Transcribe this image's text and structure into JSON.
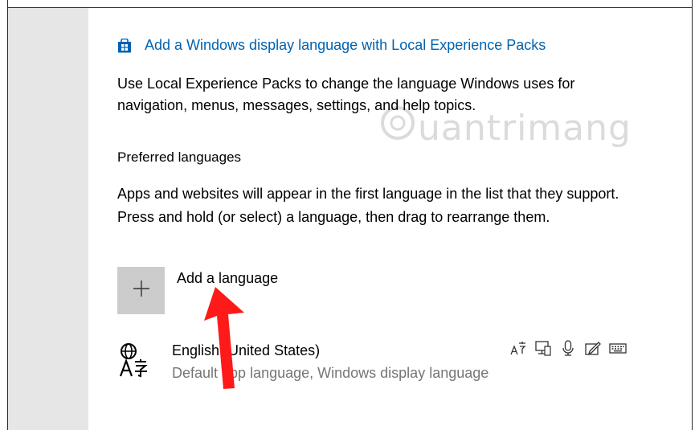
{
  "links": {
    "lxp": "Add a Windows display language with Local Experience Packs"
  },
  "description": "Use Local Experience Packs to change the language Windows uses for navigation, menus, messages, settings, and help topics.",
  "preferred_languages": {
    "title": "Preferred languages",
    "description": "Apps and websites will appear in the first language in the list that they support. Press and hold (or select) a language, then drag to rearrange them.",
    "add_label": "Add a language",
    "items": [
      {
        "name": "English (United States)",
        "subtitle": "Default app language, Windows display language"
      }
    ]
  },
  "icons": {
    "store": "store-bag-icon",
    "add": "plus-icon",
    "language": "language-glyph-icon",
    "features": [
      "text-to-speech-icon",
      "display-language-icon",
      "speech-recognition-icon",
      "handwriting-icon",
      "keyboard-icon"
    ]
  },
  "colors": {
    "link": "#0063b1",
    "rail": "#e6e6e6",
    "tile": "#cccccc",
    "secondary_text": "#767676",
    "arrow": "#ff1a1a"
  },
  "watermark": "uantrimang"
}
